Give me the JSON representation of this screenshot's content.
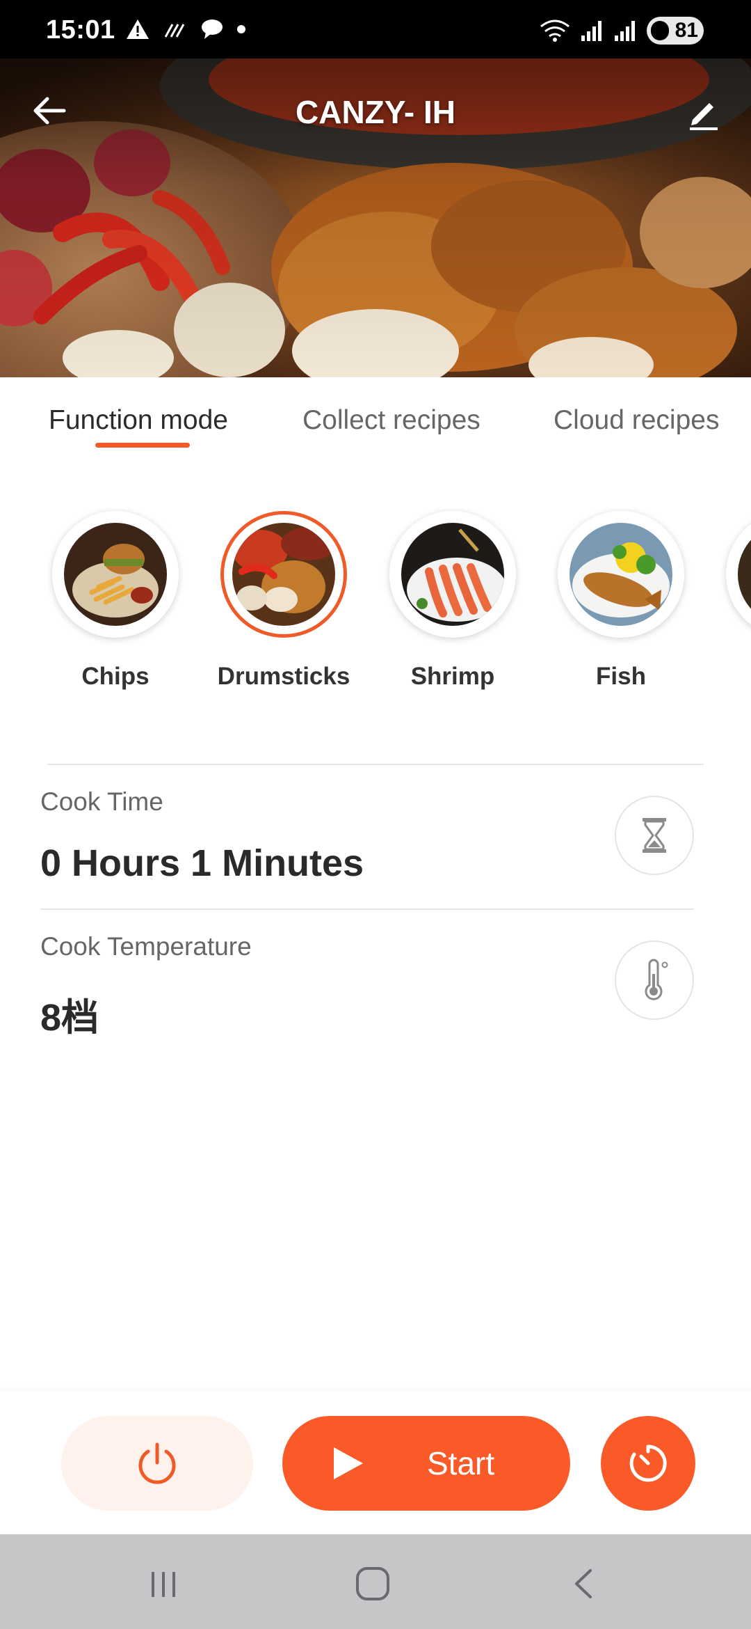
{
  "status_bar": {
    "time": "15:01",
    "battery": "81"
  },
  "header": {
    "title": "CANZY- IH"
  },
  "tabs": [
    {
      "label": "Function mode",
      "active": true
    },
    {
      "label": "Collect recipes",
      "active": false
    },
    {
      "label": "Cloud recipes",
      "active": false
    }
  ],
  "modes": [
    {
      "label": "Chips",
      "selected": false
    },
    {
      "label": "Drumsticks",
      "selected": true
    },
    {
      "label": "Shrimp",
      "selected": false
    },
    {
      "label": "Fish",
      "selected": false
    }
  ],
  "settings": {
    "cook_time": {
      "label": "Cook Time",
      "value": "0 Hours 1 Minutes"
    },
    "cook_temperature": {
      "label": "Cook Temperature",
      "value": "8档"
    }
  },
  "controls": {
    "start_label": "Start"
  },
  "colors": {
    "accent": "#fa5a28",
    "accent_light": "#fff1ec",
    "status_bar": "#000000",
    "nav_bar": "#c6c6c9"
  }
}
